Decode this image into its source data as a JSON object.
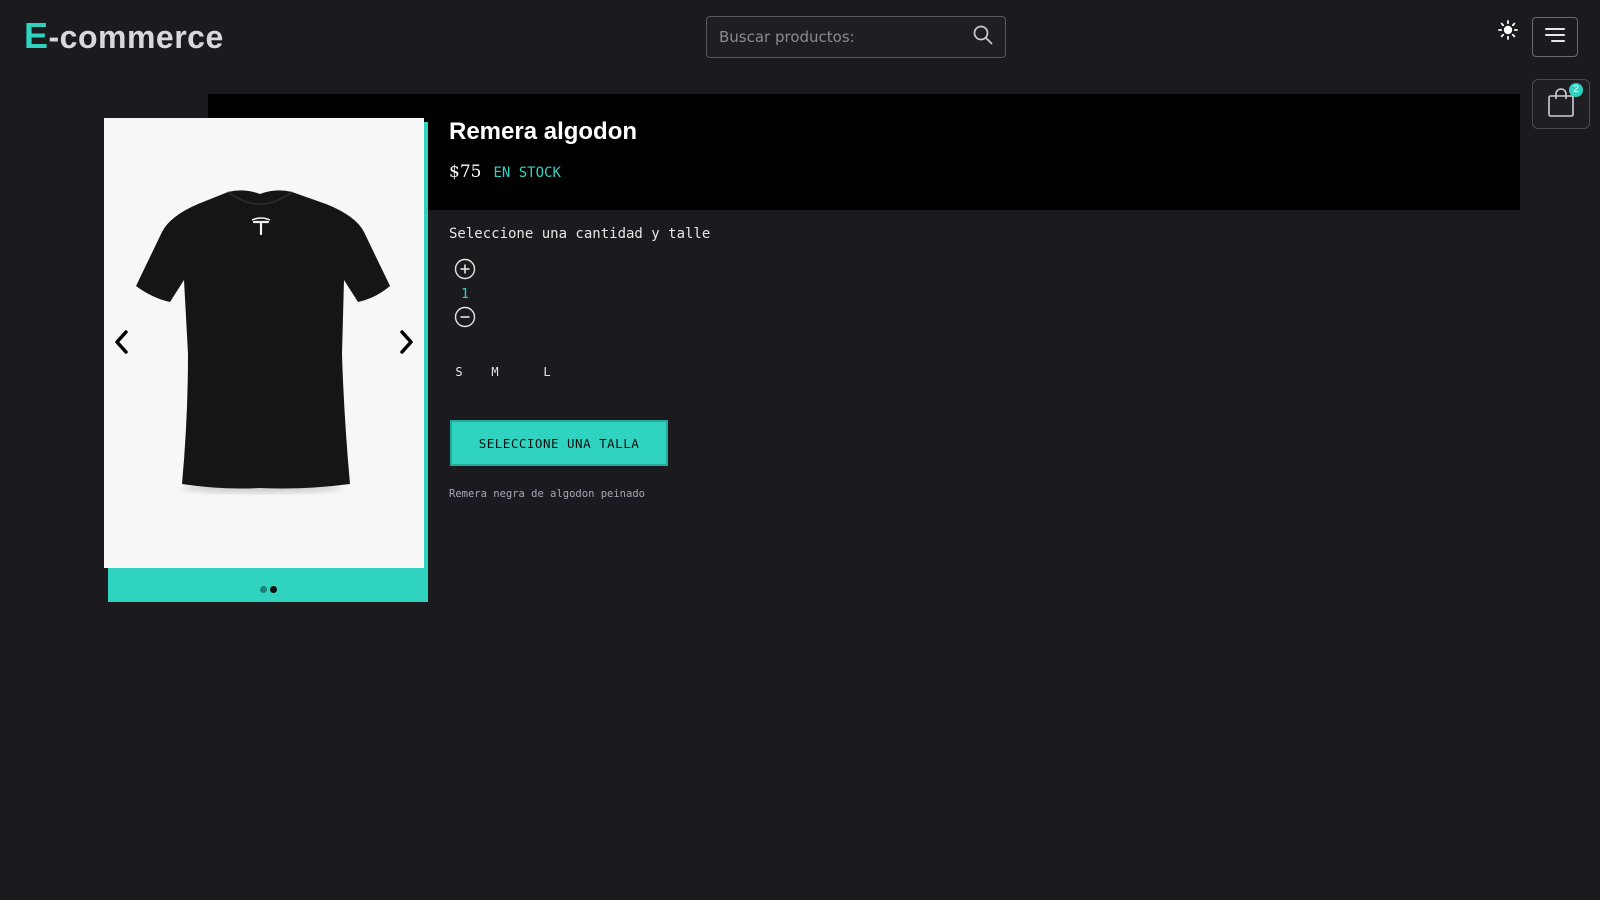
{
  "header": {
    "logo_accent": "E",
    "logo_rest": "-commerce",
    "search_placeholder": "Buscar productos:",
    "cart_count": "2"
  },
  "product": {
    "title": "Remera algodon",
    "price": "$75",
    "stock_status": "EN STOCK",
    "instructions": "Seleccione una cantidad y talle",
    "quantity": "1",
    "sizes": [
      "S",
      "M",
      "L"
    ],
    "cta_label": "SELECCIONE UNA TALLA",
    "description": "Remera negra de algodon peinado",
    "carousel_total_images": 2,
    "carousel_active_index": 1
  },
  "colors": {
    "background": "#1b1b1f",
    "accent": "#2fd3c0",
    "band": "#000000"
  },
  "icons": {
    "search": "search-icon",
    "theme": "sun-icon",
    "menu": "hamburger-icon",
    "cart": "shopping-bag-icon",
    "prev": "chevron-left-icon",
    "next": "chevron-right-icon",
    "increment": "plus-circle-icon",
    "decrement": "minus-circle-icon"
  }
}
